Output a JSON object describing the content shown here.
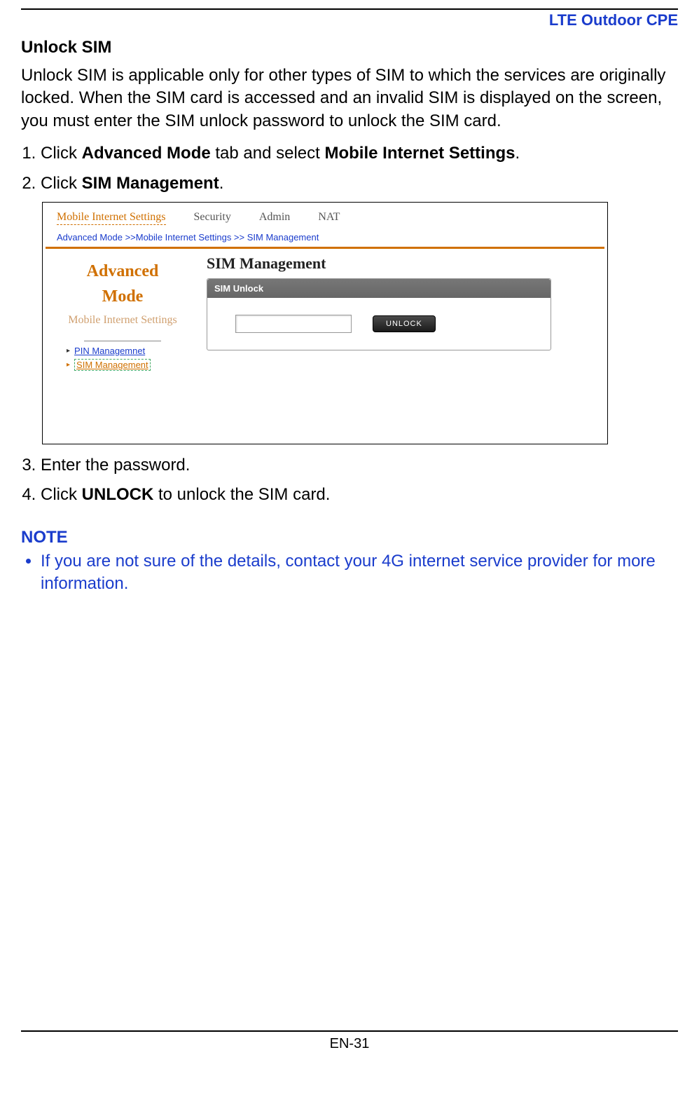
{
  "header": {
    "product": "LTE Outdoor CPE"
  },
  "doc": {
    "section_title": "Unlock SIM",
    "intro": "Unlock SIM is applicable only for other types of SIM to which the services are originally locked. When the SIM card is accessed and an invalid SIM is displayed on the screen, you must enter the SIM unlock password to unlock the SIM card.",
    "steps": {
      "s1_a": "Click ",
      "s1_b": "Advanced Mode",
      "s1_c": " tab and select ",
      "s1_d": "Mobile Internet Settings",
      "s1_e": ".",
      "s2_a": "Click ",
      "s2_b": "SIM Management",
      "s2_c": ".",
      "s3": "Enter the password.",
      "s4_a": "Click ",
      "s4_b": "UNLOCK",
      "s4_c": " to unlock the SIM card."
    },
    "note_heading": "NOTE",
    "note_item": "If you are not sure of the details, contact your 4G internet service provider for more information."
  },
  "screenshot": {
    "tabs": {
      "mobile": "Mobile Internet Settings",
      "security": "Security",
      "admin": "Admin",
      "nat": "NAT"
    },
    "breadcrumb": "Advanced Mode >>Mobile Internet Settings >> SIM Management",
    "sidebar": {
      "heading_line1": "Advanced",
      "heading_line2": "Mode",
      "sub_label": "Mobile Internet Settings",
      "link1": "PIN Managemnet",
      "link2": "SIM Management"
    },
    "panel": {
      "title": "SIM Management",
      "card_title": "SIM Unlock",
      "button": "UNLOCK"
    }
  },
  "footer": {
    "page": "EN-31"
  }
}
